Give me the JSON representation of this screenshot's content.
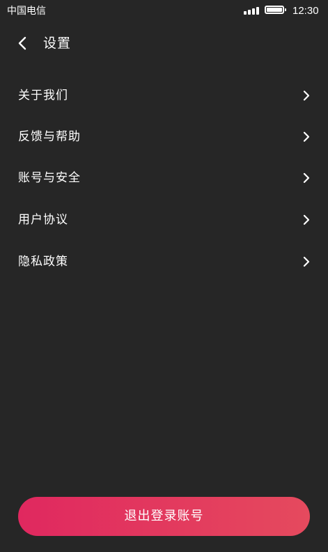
{
  "status_bar": {
    "carrier": "中国电信",
    "time": "12:30",
    "icons": [
      "signal-icon",
      "battery-icon"
    ]
  },
  "header": {
    "back_icon": "chevron-left-icon",
    "title": "设置"
  },
  "menu": [
    {
      "label": "关于我们",
      "icon": "chevron-right-icon"
    },
    {
      "label": "反馈与帮助",
      "icon": "chevron-right-icon"
    },
    {
      "label": "账号与安全",
      "icon": "chevron-right-icon"
    },
    {
      "label": "用户协议",
      "icon": "chevron-right-icon"
    },
    {
      "label": "隐私政策",
      "icon": "chevron-right-icon"
    }
  ],
  "logout": {
    "label": "退出登录账号"
  },
  "colors": {
    "background": "#262626",
    "text": "#ffffff",
    "accent_start": "#e0285f",
    "accent_end": "#e54a5e"
  }
}
